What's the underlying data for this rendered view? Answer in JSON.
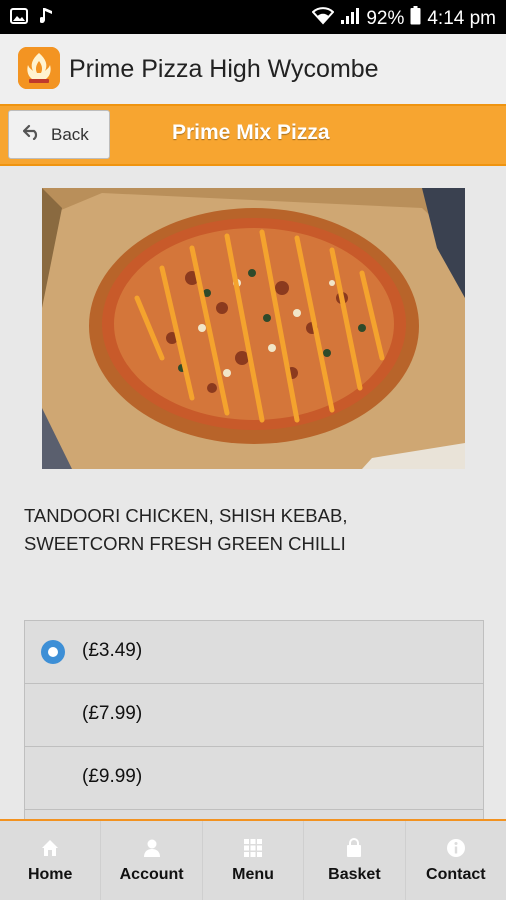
{
  "status_bar": {
    "battery": "92%",
    "time": "4:14 pm"
  },
  "app_bar": {
    "title": "Prime Pizza High Wycombe"
  },
  "sub_bar": {
    "back_label": "Back",
    "title": "Prime Mix Pizza"
  },
  "item": {
    "description": "TANDOORI CHICKEN, SHISH KEBAB, SWEETCORN FRESH GREEN CHILLI"
  },
  "options": [
    {
      "price": "(£3.49)",
      "selected": true
    },
    {
      "price": "(£7.99)",
      "selected": false
    },
    {
      "price": "(£9.99)",
      "selected": false
    },
    {
      "price": "",
      "selected": false
    }
  ],
  "nav": {
    "home": "Home",
    "account": "Account",
    "menu": "Menu",
    "basket": "Basket",
    "contact": "Contact"
  }
}
